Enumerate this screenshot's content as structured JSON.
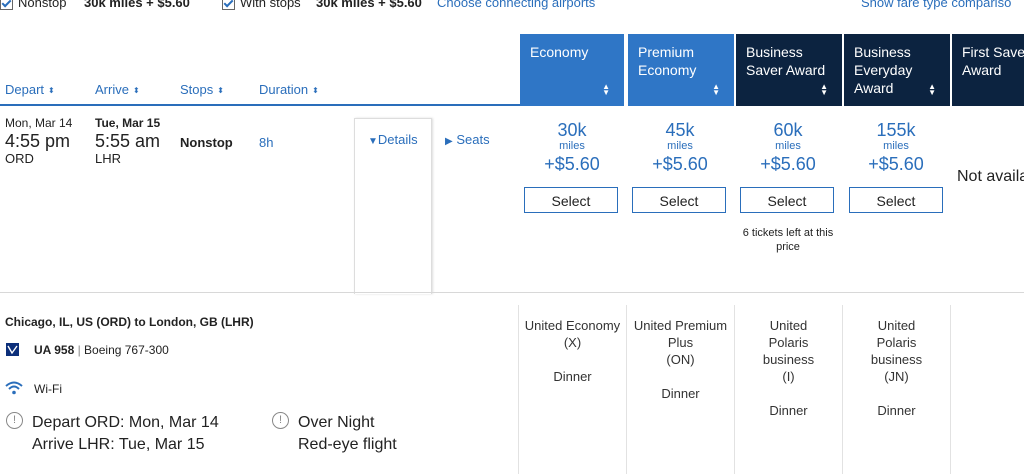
{
  "filters": {
    "nonstop_label": "Nonstop",
    "nonstop_price": "30k miles + $5.60",
    "withstops_label": "With stops",
    "withstops_price": "30k miles + $5.60",
    "connecting_link": "Choose connecting airports",
    "fare_type_link": "Show fare type compariso"
  },
  "columns": {
    "depart": "Depart",
    "arrive": "Arrive",
    "stops": "Stops",
    "duration": "Duration"
  },
  "fare_headers": [
    {
      "label": "Economy",
      "color": "#2f76c6"
    },
    {
      "label": "Premium Economy",
      "color": "#2f76c6"
    },
    {
      "label": "Business Saver Award",
      "color": "#0c2340"
    },
    {
      "label": "Business Everyday Award",
      "color": "#0c2340"
    },
    {
      "label": "First Saver Award",
      "color": "#0c2340"
    }
  ],
  "flight": {
    "depart_date": "Mon, Mar 14",
    "depart_time": "4:55 pm",
    "depart_airport": "ORD",
    "arrive_date": "Tue, Mar 15",
    "arrive_time": "5:55 am",
    "arrive_airport": "LHR",
    "stops": "Nonstop",
    "duration": "8h",
    "details_link": "Details",
    "seats_link": "Seats"
  },
  "prices": [
    {
      "miles": "30k",
      "miles_label": "miles",
      "fee": "+$5.60",
      "button": "Select",
      "note": ""
    },
    {
      "miles": "45k",
      "miles_label": "miles",
      "fee": "+$5.60",
      "button": "Select",
      "note": ""
    },
    {
      "miles": "60k",
      "miles_label": "miles",
      "fee": "+$5.60",
      "button": "Select",
      "note": "6 tickets left at this price"
    },
    {
      "miles": "155k",
      "miles_label": "miles",
      "fee": "+$5.60",
      "button": "Select",
      "note": ""
    }
  ],
  "first_saver_status": "Not availa",
  "details": {
    "route": "Chicago, IL, US (ORD) to London, GB (LHR)",
    "flight_number": "UA 958",
    "aircraft": "Boeing 767-300",
    "wifi": "Wi-Fi",
    "depart_info": "Depart ORD: Mon, Mar 14",
    "arrive_info": "Arrive LHR: Tue, Mar 15",
    "overnight_title": "Over Night",
    "overnight_sub": "Red-eye flight"
  },
  "cabins": [
    {
      "name": "United Economy",
      "code": "(X)",
      "meal": "Dinner"
    },
    {
      "name": "United Premium Plus",
      "code": "(ON)",
      "meal": "Dinner"
    },
    {
      "name": "United Polaris business",
      "code": "(I)",
      "meal": "Dinner"
    },
    {
      "name": "United Polaris business",
      "code": "(JN)",
      "meal": "Dinner"
    }
  ]
}
